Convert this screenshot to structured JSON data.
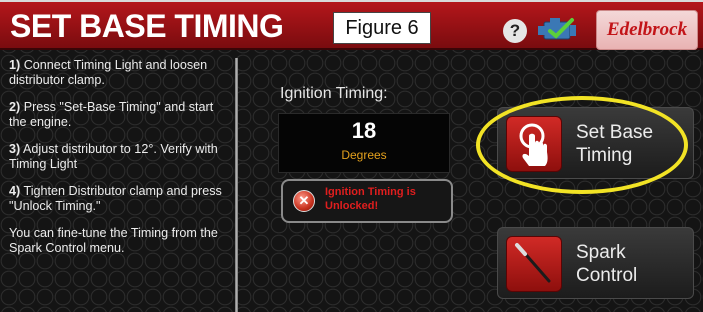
{
  "header": {
    "title": "SET BASE TIMING",
    "figure_label": "Figure 6",
    "help_label": "?",
    "brand": "Edelbrock"
  },
  "instructions": [
    {
      "num": "1)",
      "text": "Connect Timing Light and loosen distributor clamp."
    },
    {
      "num": "2)",
      "text": "Press \"Set-Base Timing\" and start the engine."
    },
    {
      "num": "3)",
      "text": "Adjust distributor to 12°. Verify with Timing Light"
    },
    {
      "num": "4)",
      "text": "Tighten Distributor clamp and press \"Unlock Timing.\""
    },
    {
      "num": "",
      "text": "You can fine-tune the Timing from the Spark Control menu."
    }
  ],
  "timing": {
    "heading": "Ignition Timing:",
    "value": "18",
    "unit": "Degrees",
    "lock_status": "Ignition Timing is Unlocked!"
  },
  "buttons": {
    "set_base_timing": "Set Base Timing",
    "spark_control": "Spark Control"
  },
  "colors": {
    "header_red": "#b4161b",
    "accent_amber": "#e3a01d",
    "warning_red": "#e01e1e",
    "highlight_yellow": "#f2e325",
    "engine_icon_green": "#5ccf3a"
  },
  "icons": {
    "set_base_timing": "touch-finger-icon",
    "spark_control": "screwdriver-icon",
    "engine_status": "engine-check-icon",
    "lock_status": "unlocked-x-icon"
  }
}
